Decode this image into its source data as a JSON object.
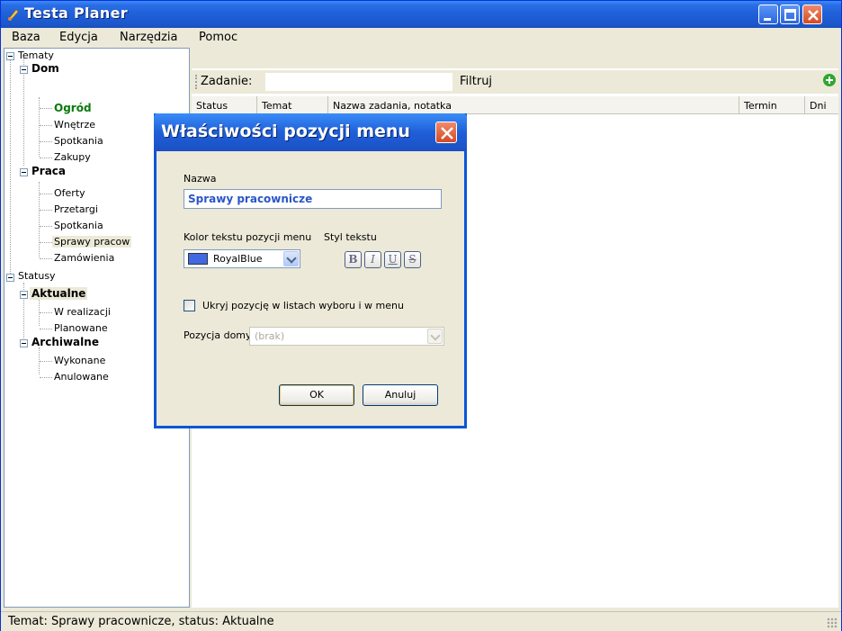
{
  "app": {
    "title": "Testa Planer"
  },
  "menu": [
    "Baza",
    "Edycja",
    "Narzędzia",
    "Pomoc"
  ],
  "tree": {
    "tematy": "Tematy",
    "dom": "Dom",
    "dom_items": [
      "Ogród",
      "Wnętrze",
      "Spotkania",
      "Zakupy"
    ],
    "praca": "Praca",
    "praca_items": [
      "Oferty",
      "Przetargi",
      "Spotkania",
      "Sprawy pracow",
      "Zamówienia"
    ],
    "statusy": "Statusy",
    "aktualne": "Aktualne",
    "aktualne_items": [
      "W realizacji",
      "Planowane"
    ],
    "archiwalne": "Archiwalne",
    "archiwalne_items": [
      "Wykonane",
      "Anulowane"
    ]
  },
  "filter": {
    "label": "Zadanie:",
    "value": "",
    "filter_label": "Filtruj"
  },
  "columns": [
    "Status",
    "Temat",
    "Nazwa zadania, notatka",
    "Termin",
    "Dni"
  ],
  "status_bar": "Temat: Sprawy pracownicze, status: Aktualne",
  "dialog": {
    "title": "Właściwości pozycji menu",
    "name_label": "Nazwa",
    "name_value": "Sprawy pracownicze",
    "color_label": "Kolor tekstu pozycji menu",
    "color_value": "RoyalBlue",
    "color_hex": "#4169e1",
    "style_label": "Styl tekstu",
    "style_buttons": [
      "B",
      "I",
      "U",
      "S"
    ],
    "hide_label": "Ukryj pozycję w listach wyboru i w menu",
    "hide_checked": false,
    "default_pos_label": "Pozycja domyślna",
    "default_pos_value": "(brak)",
    "ok": "OK",
    "cancel": "Anuluj"
  }
}
